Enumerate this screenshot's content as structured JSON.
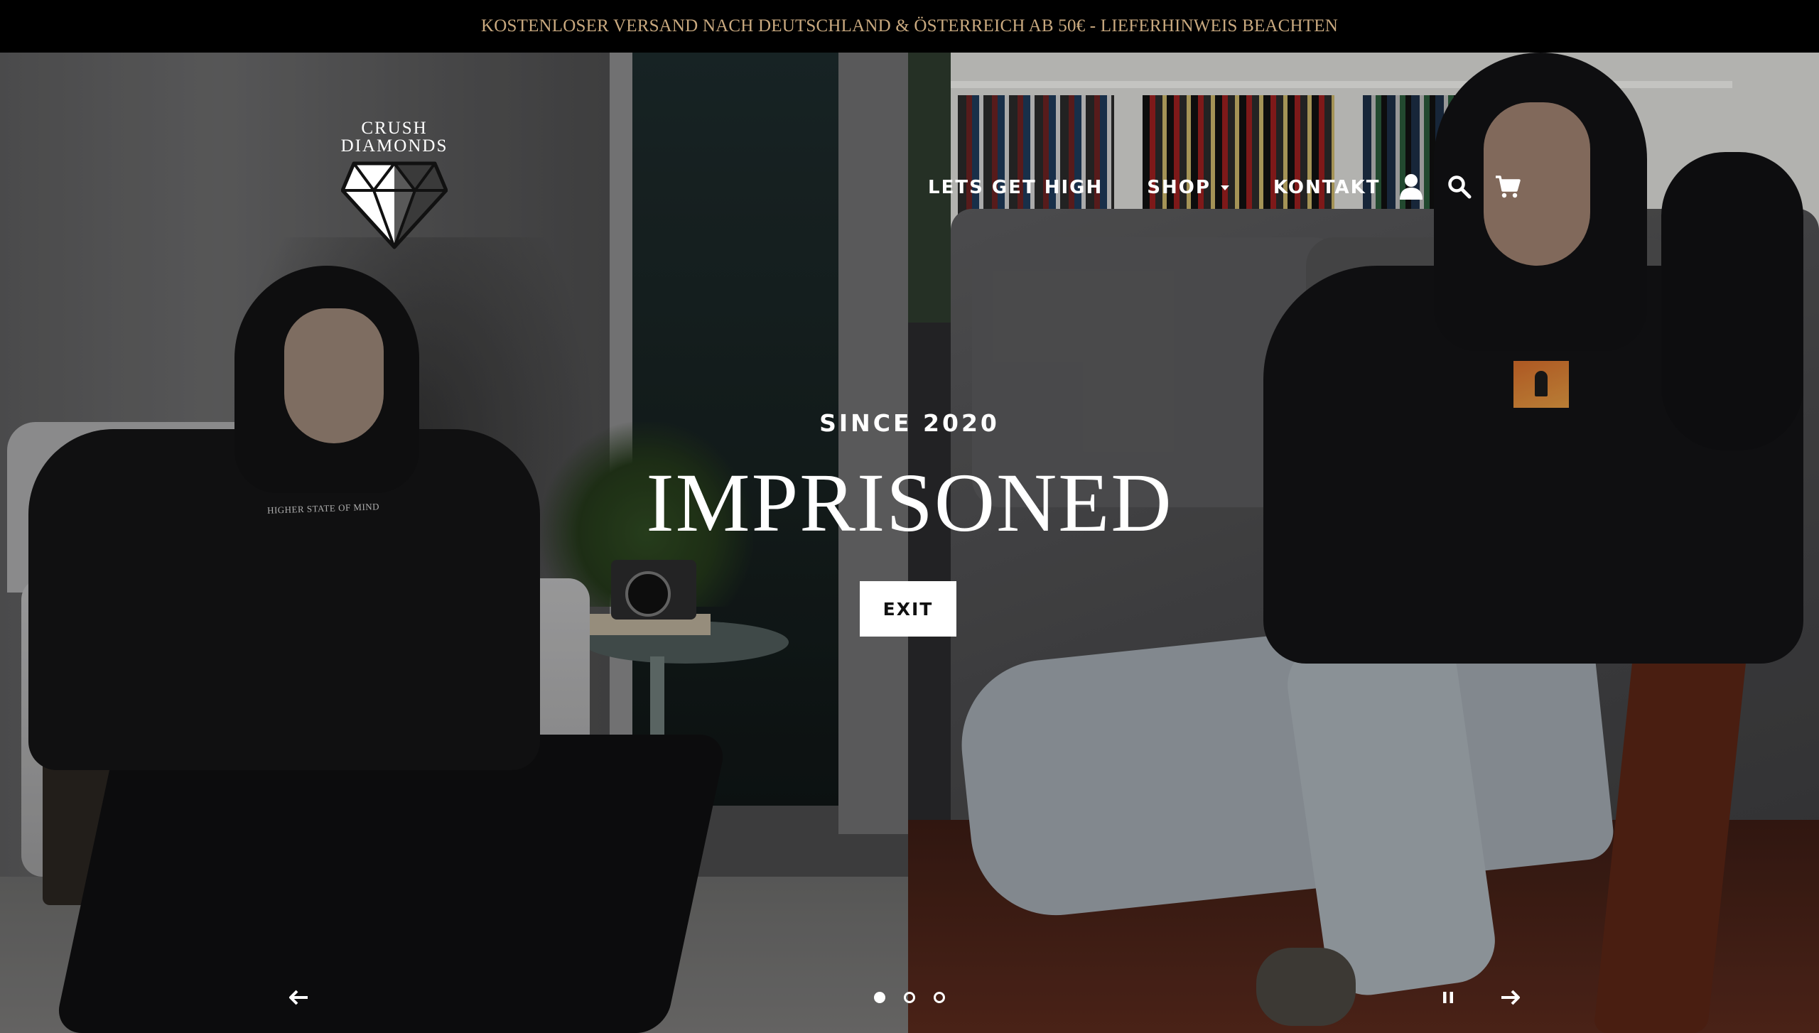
{
  "announcement": {
    "text": "KOSTENLOSER VERSAND NACH DEUTSCHLAND & ÖSTERREICH AB 50€ - LIEFERHINWEIS BEACHTEN",
    "color": "#c9a97f",
    "background": "#000000"
  },
  "logo": {
    "line1": "CRUSH",
    "line2": "DIAMONDS",
    "icon": "diamond-icon"
  },
  "nav": {
    "items": [
      {
        "label": "LETS GET HIGH"
      },
      {
        "label": "SHOP",
        "has_dropdown": true
      },
      {
        "label": "KONTAKT"
      }
    ],
    "icons": [
      "account-icon",
      "search-icon",
      "cart-icon"
    ]
  },
  "hero": {
    "eyebrow": "SINCE 2020",
    "headline": "IMPRISONED",
    "button_label": "EXIT",
    "hoodie_print": "HIGHER STATE OF MIND"
  },
  "slideshow": {
    "slide_count": 3,
    "active_slide": 1,
    "icons": [
      "arrow-left-icon",
      "pause-icon",
      "arrow-right-icon"
    ]
  }
}
